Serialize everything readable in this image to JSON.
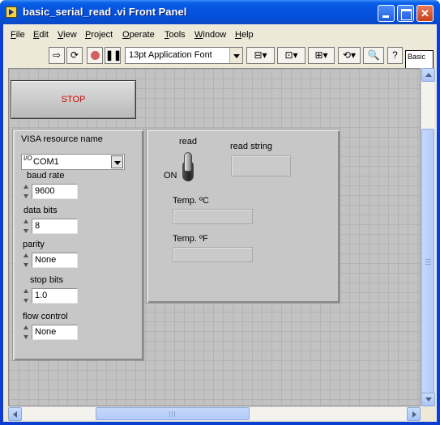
{
  "window": {
    "title": "basic_serial_read .vi Front Panel"
  },
  "menu": [
    {
      "label": "File",
      "mnemonic": "F",
      "rest": "ile"
    },
    {
      "label": "Edit",
      "mnemonic": "E",
      "rest": "dit"
    },
    {
      "label": "View",
      "mnemonic": "V",
      "rest": "iew"
    },
    {
      "label": "Project",
      "mnemonic": "P",
      "rest": "roject"
    },
    {
      "label": "Operate",
      "mnemonic": "O",
      "rest": "perate"
    },
    {
      "label": "Tools",
      "mnemonic": "T",
      "rest": "ools"
    },
    {
      "label": "Window",
      "mnemonic": "W",
      "rest": "indow"
    },
    {
      "label": "Help",
      "mnemonic": "H",
      "rest": "elp"
    }
  ],
  "toolbar": {
    "font": "13pt Application Font",
    "help_glyph": "?",
    "palette_label": "Basic"
  },
  "panel": {
    "stop_label": "STOP",
    "visa": {
      "label": "VISA resource name",
      "value": "COM1",
      "io_glyph": "I/O"
    },
    "baud_rate": {
      "label": "baud rate",
      "value": "9600"
    },
    "data_bits": {
      "label": "data bits",
      "value": "8"
    },
    "parity": {
      "label": "parity",
      "value": "None"
    },
    "stop_bits": {
      "label": "stop bits",
      "value": "1.0"
    },
    "flow_control": {
      "label": "flow control",
      "value": "None"
    },
    "read_switch": {
      "label": "read",
      "state_label": "ON"
    },
    "read_string": {
      "label": "read string",
      "value": ""
    },
    "temp_c": {
      "label": "Temp. ºC",
      "value": ""
    },
    "temp_f": {
      "label": "Temp. ºF",
      "value": ""
    }
  },
  "colors": {
    "title_bar": "#0553e0",
    "stop_text": "#e00000",
    "panel_grid": "#c2c2c2"
  }
}
